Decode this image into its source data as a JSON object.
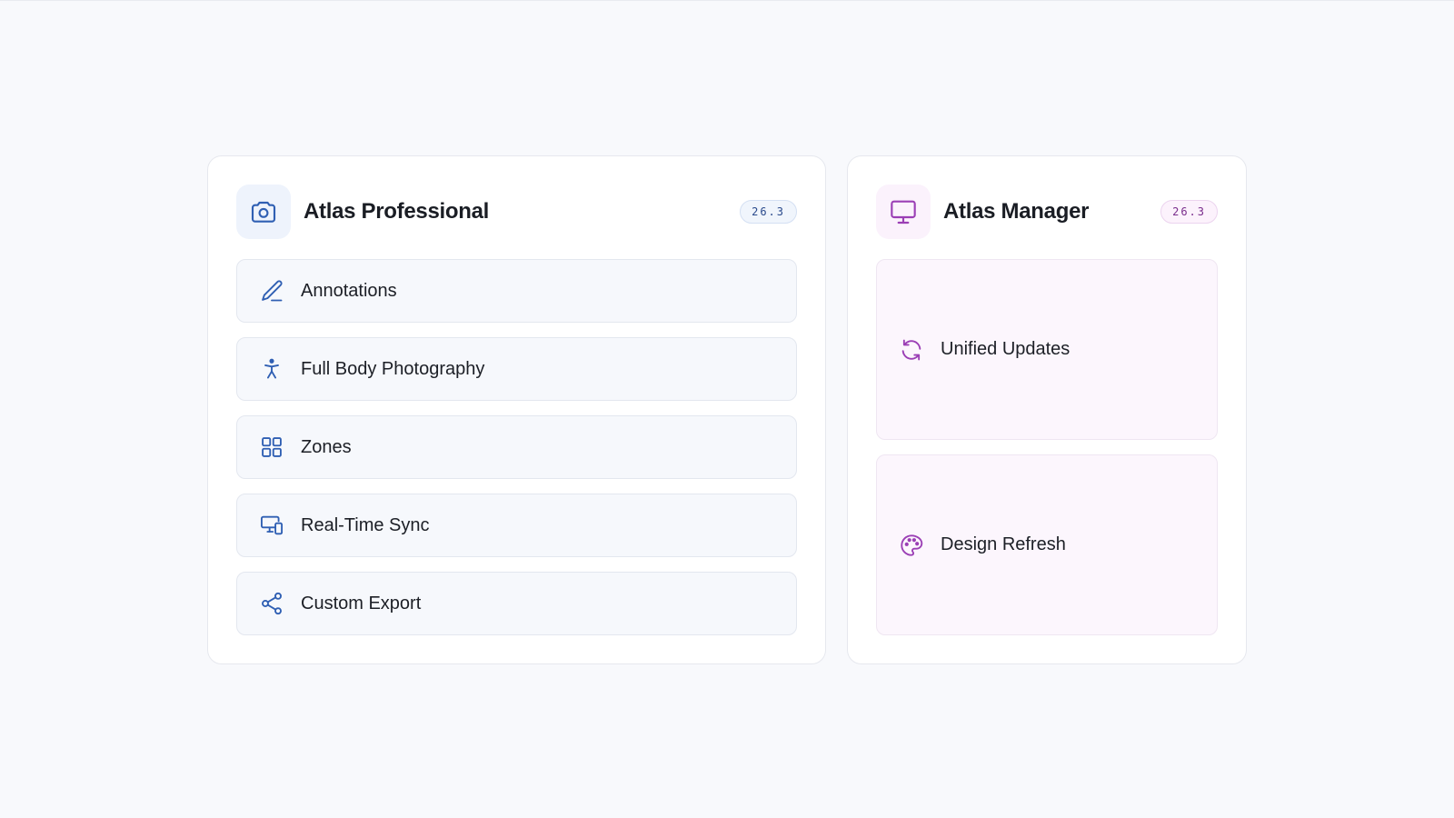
{
  "colors": {
    "pro_accent": "#2f5fb3",
    "mgr_accent": "#9b3fb5",
    "background": "#f8f9fc"
  },
  "professional": {
    "title": "Atlas Professional",
    "version": "26.3",
    "icon": "camera-icon",
    "features": [
      {
        "label": "Annotations",
        "icon": "pen-icon"
      },
      {
        "label": "Full Body Photography",
        "icon": "person-icon"
      },
      {
        "label": "Zones",
        "icon": "grid-icon"
      },
      {
        "label": "Real-Time Sync",
        "icon": "devices-icon"
      },
      {
        "label": "Custom Export",
        "icon": "share-icon"
      }
    ]
  },
  "manager": {
    "title": "Atlas Manager",
    "version": "26.3",
    "icon": "monitor-icon",
    "features": [
      {
        "label": "Unified Updates",
        "icon": "refresh-icon"
      },
      {
        "label": "Design Refresh",
        "icon": "palette-icon"
      }
    ]
  }
}
